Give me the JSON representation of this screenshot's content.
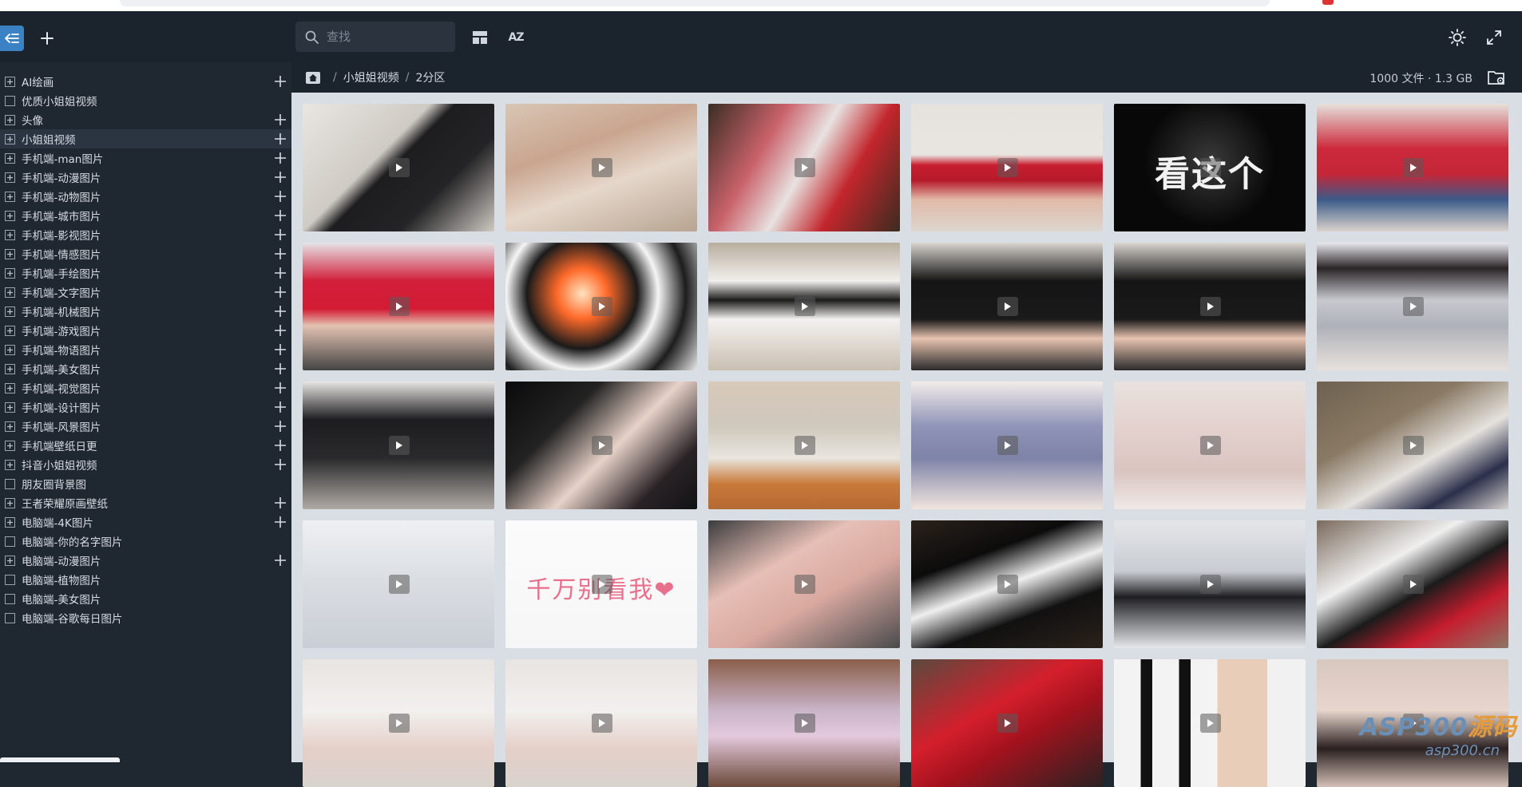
{
  "toolbar": {
    "search_placeholder": "查找",
    "sort_label": "AZ",
    "icons": [
      "collapse-sidebar-icon",
      "plus-icon",
      "search-icon",
      "layout-icon",
      "sort-az-icon",
      "sun-icon",
      "fullscreen-icon"
    ]
  },
  "sidebar": {
    "items": [
      {
        "label": "AI绘画",
        "expandable": true,
        "addable": true
      },
      {
        "label": "优质小姐姐视频",
        "expandable": false,
        "addable": false
      },
      {
        "label": "头像",
        "expandable": true,
        "addable": true
      },
      {
        "label": "小姐姐视频",
        "expandable": true,
        "addable": true,
        "active": true
      },
      {
        "label": "手机端-man图片",
        "expandable": true,
        "addable": true
      },
      {
        "label": "手机端-动漫图片",
        "expandable": true,
        "addable": true
      },
      {
        "label": "手机端-动物图片",
        "expandable": true,
        "addable": true
      },
      {
        "label": "手机端-城市图片",
        "expandable": true,
        "addable": true
      },
      {
        "label": "手机端-影视图片",
        "expandable": true,
        "addable": true
      },
      {
        "label": "手机端-情感图片",
        "expandable": true,
        "addable": true
      },
      {
        "label": "手机端-手绘图片",
        "expandable": true,
        "addable": true
      },
      {
        "label": "手机端-文字图片",
        "expandable": true,
        "addable": true
      },
      {
        "label": "手机端-机械图片",
        "expandable": true,
        "addable": true
      },
      {
        "label": "手机端-游戏图片",
        "expandable": true,
        "addable": true
      },
      {
        "label": "手机端-物语图片",
        "expandable": true,
        "addable": true
      },
      {
        "label": "手机端-美女图片",
        "expandable": true,
        "addable": true
      },
      {
        "label": "手机端-视觉图片",
        "expandable": true,
        "addable": true
      },
      {
        "label": "手机端-设计图片",
        "expandable": true,
        "addable": true
      },
      {
        "label": "手机端-风景图片",
        "expandable": true,
        "addable": true
      },
      {
        "label": "手机端壁纸日更",
        "expandable": true,
        "addable": true
      },
      {
        "label": "抖音小姐姐视频",
        "expandable": true,
        "addable": true
      },
      {
        "label": "朋友圈背景图",
        "expandable": false,
        "addable": false
      },
      {
        "label": "王者荣耀原画壁纸",
        "expandable": true,
        "addable": true
      },
      {
        "label": "电脑端-4K图片",
        "expandable": true,
        "addable": true
      },
      {
        "label": "电脑端-你的名字图片",
        "expandable": false,
        "addable": false
      },
      {
        "label": "电脑端-动漫图片",
        "expandable": true,
        "addable": true
      },
      {
        "label": "电脑端-植物图片",
        "expandable": false,
        "addable": false
      },
      {
        "label": "电脑端-美女图片",
        "expandable": false,
        "addable": false
      },
      {
        "label": "电脑端-谷歌每日图片",
        "expandable": false,
        "addable": false
      }
    ]
  },
  "breadcrumb": {
    "items": [
      "小姐姐视频",
      "2分区"
    ],
    "separator": "/",
    "stats": "1000 文件 · 1.3 GB"
  },
  "thumbnails": [
    {
      "bg": "linear-gradient(135deg,#e9e6e2 0%,#cfcac4 40%,#1d1d1f 48%,#242426 70%,#cfc9c3 100%)"
    },
    {
      "bg": "linear-gradient(160deg,#d8c6b5 0%,#c9a58e 35%,#e6d7cb 60%,#b7a491 100%)"
    },
    {
      "bg": "linear-gradient(120deg,#3b2d24 0%,#c9626a 30%,#e8e2e1 50%,#c2262c 70%,#3a2c20 100%)"
    },
    {
      "bg": "linear-gradient(180deg,#e6e3df 0%,#e8e4df 40%,#c81e30 48%,#b51a2a 60%,#e0b9a6 75%,#dcd6cf 100%)"
    },
    {
      "bg": "radial-gradient(circle at 50% 45%,#3a3a3a 0%,#080808 55%)",
      "text": "看这个"
    },
    {
      "bg": "linear-gradient(180deg,#e6e1db 0%,#cc2a3c 35%,#c42638 55%,#3c5a88 75%,#d9d3cc 100%)"
    },
    {
      "bg": "linear-gradient(180deg,#e5e3e6 0%,#d21f3a 30%,#d31c34 52%,#e3c2b2 65%,#444 100%)"
    },
    {
      "bg": "radial-gradient(circle at 40% 40%,#ffe3c0 0%,#ff6a2a 18%,#1a1a1a 40%,#f5f5f5 55%,#1d1d1d 75%,#e8e8e8 100%)"
    },
    {
      "bg": "linear-gradient(180deg,#b8ad9e 0%,#f1efec 30%,#1c1c1c 45%,#f3f1ef 60%,#c9bfb1 100%)"
    },
    {
      "bg": "linear-gradient(180deg,#d9d5cf 0%,#151515 30%,#1a1a1a 60%,#e8c3b0 75%,#2b2b2b 100%)"
    },
    {
      "bg": "linear-gradient(180deg,#d9d5cf 0%,#151515 30%,#1a1a1a 60%,#e8c3b0 75%,#2b2b2b 100%)"
    },
    {
      "bg": "linear-gradient(180deg,#e9e9ee 0%,#2a2426 20%,#c7c9cf 45%,#aeb1b8 65%,#e6e1dc 100%)"
    },
    {
      "bg": "linear-gradient(180deg,#e8e6e4 0%,#1d1c1f 30%,#2a2a2c 60%,#b0aaa5 100%)"
    },
    {
      "bg": "linear-gradient(135deg,#0a0a0c 0%,#222 30%,#e8d2c8 55%,#2a2326 80%,#121214 100%)"
    },
    {
      "bg": "linear-gradient(180deg,#d8c9b8 0%,#cfc8bd 35%,#e9e5de 60%,#c97a3a 80%,#b56a32 100%)"
    },
    {
      "bg": "linear-gradient(180deg,#f2ece9 0%,#8f94b8 35%,#7e83a8 60%,#f0e4dd 100%)"
    },
    {
      "bg": "linear-gradient(180deg,#e8e2de 0%,#e3d0cc 40%,#d9c4c0 70%,#efe9e6 100%)"
    },
    {
      "bg": "linear-gradient(150deg,#6e6150 0%,#8a7a65 35%,#e5e2de 60%,#2b2f4a 80%,#d6d2cf 100%)"
    },
    {
      "bg": "linear-gradient(180deg,#eef0f3 0%,#d9dde2 50%,#c9ced5 100%)"
    },
    {
      "bg": "linear-gradient(180deg,#fbfbfb 0%,#f6f6f6 100%)",
      "text": "千万别看我❤",
      "textStyle": "pink"
    },
    {
      "bg": "linear-gradient(150deg,#3b3b3d 0%,#e6bfb6 35%,#d9a9a0 60%,#4a4a4c 100%)"
    },
    {
      "bg": "linear-gradient(160deg,#2a211b 0%,#0c0c0c 30%,#efefef 50%,#111 70%,#2a211b 100%)"
    },
    {
      "bg": "linear-gradient(180deg,#e4e6e9 0%,#c8ccd2 40%,#1f1f22 60%,#e6e8eb 100%)"
    },
    {
      "bg": "linear-gradient(150deg,#7a6a5c 0%,#efefef 35%,#1b1b1b 55%,#c51d2e 75%,#8c7766 100%)"
    },
    {
      "bg": "linear-gradient(180deg,#e8e4e1 0%,#f2f0ee 40%,#e5cfc8 70%,#d8d2cd 100%)"
    },
    {
      "bg": "linear-gradient(180deg,#e8e4e1 0%,#f2f0ee 40%,#e5cfc8 70%,#d8d2cd 100%)"
    },
    {
      "bg": "linear-gradient(180deg,#8a5e4a 0%,#c9b4c8 40%,#e4c9dd 60%,#6b4a3a 100%)"
    },
    {
      "bg": "linear-gradient(150deg,#5a4a3e 0%,#d41f2c 40%,#a3121d 60%,#2a2222 100%)"
    },
    {
      "bg": "linear-gradient(90deg,#f3f3f3 0 14%,#111 14% 20%,#f3f3f3 20% 34%,#111 34% 40%,#f3f3f3 40% 54%,#e8cdb8 54% 80%,#f1f1f1 80% 100%)"
    },
    {
      "bg": "linear-gradient(180deg,#d8c7be 0%,#e8d6cd 40%,#2a2020 70%,#d3bfb5 100%)"
    }
  ],
  "watermark": {
    "line1_a": "ASP300",
    "line1_b": "源码",
    "line2": "asp300.cn"
  }
}
